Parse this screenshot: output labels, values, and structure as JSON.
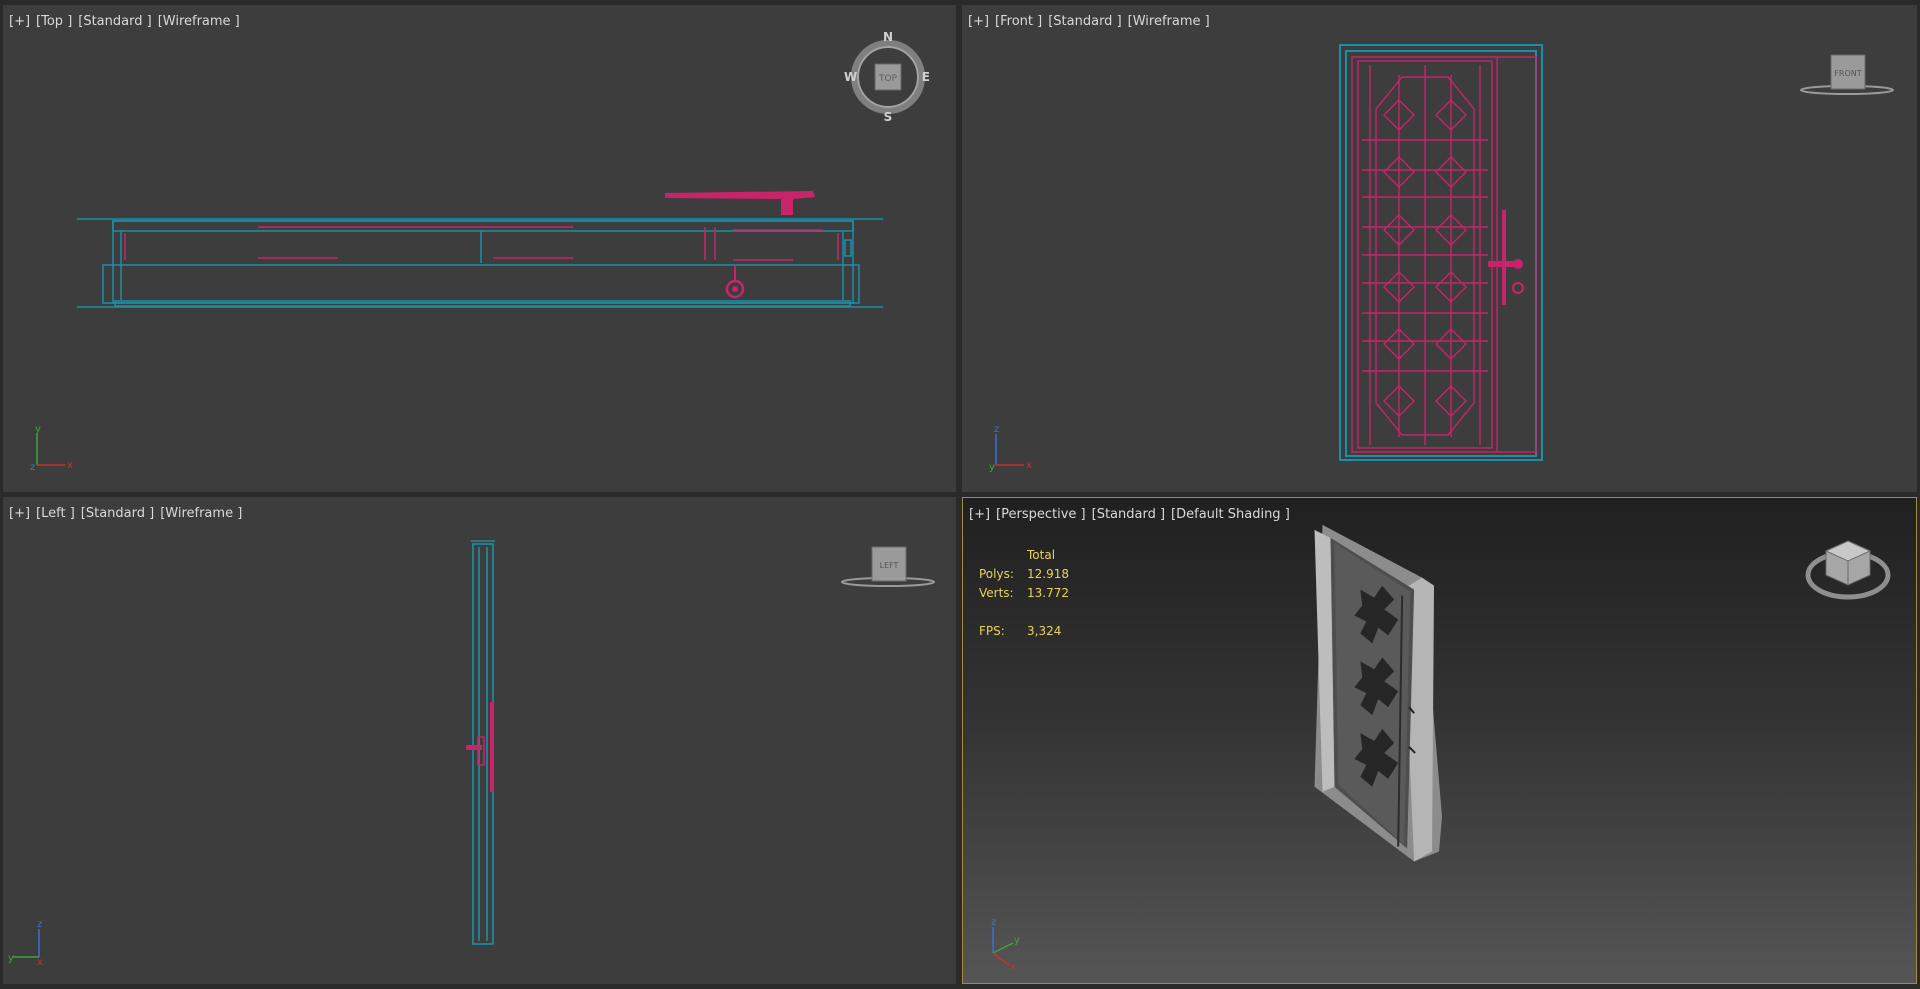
{
  "viewports": {
    "top": {
      "plus": "[+]",
      "view": "[Top ]",
      "mode": "[Standard ]",
      "shading": "[Wireframe ]",
      "compass": {
        "n": "N",
        "s": "S",
        "e": "E",
        "w": "W",
        "cube": "TOP"
      },
      "axes": {
        "up": "y",
        "right": "x",
        "center": "z"
      }
    },
    "front": {
      "plus": "[+]",
      "view": "[Front ]",
      "mode": "[Standard ]",
      "shading": "[Wireframe ]",
      "cube": "FRONT",
      "axes": {
        "up": "z",
        "right": "x",
        "center": "y"
      }
    },
    "left": {
      "plus": "[+]",
      "view": "[Left ]",
      "mode": "[Standard ]",
      "shading": "[Wireframe ]",
      "cube": "LEFT",
      "axes": {
        "up": "z",
        "left": "y",
        "center": "x"
      }
    },
    "perspective": {
      "plus": "[+]",
      "view": "[Perspective ]",
      "mode": "[Standard ]",
      "shading": "[Default Shading ]",
      "axes": {
        "up": "z",
        "right": "y",
        "down": "x"
      }
    }
  },
  "stats": {
    "header": "Total",
    "polys_label": "Polys:",
    "polys_value": "12.918",
    "verts_label": "Verts:",
    "verts_value": "13.772",
    "fps_label": "FPS:",
    "fps_value": "3,324"
  },
  "colors": {
    "viewport_bg": "#3d3d3d",
    "wire_cyan": "#1c8fa8",
    "wire_magenta": "#c8246a",
    "active_border": "#a58a3a",
    "stats_text": "#e8d35a",
    "label_text": "#d9d9d9"
  }
}
